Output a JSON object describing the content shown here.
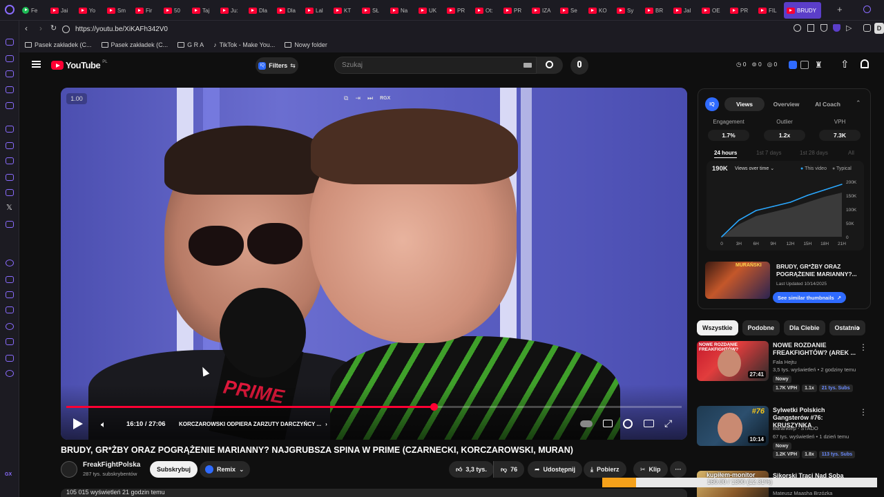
{
  "browser": {
    "tabs": [
      "Fe",
      "Jai",
      "Yo",
      "Sm",
      "Fir",
      "50",
      "Taj",
      "Ju:",
      "Dla",
      "Dla",
      "Lal",
      "KT",
      "SŁ",
      "Na",
      "UK",
      "PR",
      "Ot:",
      "PR",
      "IZA",
      "Se",
      "KO",
      "Sy",
      "BR",
      "Jal",
      "OE",
      "PR",
      "FIL"
    ],
    "active_tab": "BRUDY",
    "url": "https://youtu.be/XiKAFh342V0",
    "bookmarks": [
      "Pasek zakładek (C...",
      "Pasek zakładek (C...",
      "G R A",
      "TikTok - Make You...",
      "Nowy folder"
    ]
  },
  "youtube": {
    "logo": "YouTube",
    "logo_region": "PL",
    "filters_label": "Filters",
    "search_placeholder": "Szukaj",
    "header_counters": [
      "0",
      "0",
      "0"
    ]
  },
  "player": {
    "speed": "1.00",
    "overlay_label": "RGX",
    "time": "16:10 / 27:06",
    "chapter": "KORCZAROWSKI ODPIERA ZARZUTY DARCZYŃCY ...",
    "progress_fraction": 0.597,
    "mic_brand": "PRIME"
  },
  "video": {
    "title": "BRUDY, GR*ŻBY ORAZ POGRĄŻENIE MARIANNY? NAJGRUBSZA SPINA W PRIME (CZARNECKI, KORCZAROWSKI, MURAN)",
    "channel": "FreakFightPolska",
    "subscribers": "287 tys. subskrybentów",
    "subscribe_label": "Subskrybuj",
    "remix_label": "Remix",
    "likes": "3,3 tys.",
    "dislikes": "76",
    "share_label": "Udostępnij",
    "download_label": "Pobierz",
    "clip_label": "Klip",
    "views_line": "105 015 wyświetleń  21 godzin temu"
  },
  "vidiq": {
    "tabs": [
      "Views",
      "Overview",
      "AI Coach"
    ],
    "stats": [
      {
        "label": "Engagement",
        "value": "1.7%"
      },
      {
        "label": "Outlier",
        "value": "1.2x"
      },
      {
        "label": "VPH",
        "value": "7.3K"
      }
    ],
    "periods": [
      "24 hours",
      "1st 7 days",
      "1st 28 days",
      "All"
    ],
    "total_views": "190K",
    "metric_selector": "Views over time",
    "legend": [
      "This video",
      "Typical"
    ],
    "related_title": "BRUDY, GR*ŻBY ORAZ POGRĄŻENIE MARIANNY?...",
    "related_updated": "Last Updated 10/14/2025",
    "similar_btn": "See similar thumbnails"
  },
  "chart_data": {
    "type": "line",
    "x": [
      "0",
      "3H",
      "6H",
      "9H",
      "12H",
      "15H",
      "18H",
      "21H"
    ],
    "y_ticks": [
      "200K",
      "150K",
      "100K",
      "50K",
      "0"
    ],
    "ylim": [
      0,
      200000
    ],
    "series": [
      {
        "name": "This video",
        "values": [
          0,
          60000,
          95000,
          110000,
          125000,
          150000,
          170000,
          190000
        ]
      },
      {
        "name": "Typical",
        "values": [
          0,
          45000,
          75000,
          90000,
          105000,
          125000,
          145000,
          160000
        ]
      }
    ]
  },
  "chips": [
    "Wszystkie",
    "Podobne",
    "Dla Ciebie",
    "Ostatnio"
  ],
  "side_videos": [
    {
      "title": "NOWE ROZDANIE FREAKFIGHTÓW? (AREK ...",
      "channel": "Fala Hejtu",
      "meta": "3,5 tys. wyświetleń • 2 godziny temu",
      "tag": "Nowy",
      "duration": "27:41",
      "badges": [
        "1.7K VPH",
        "1.1x",
        "21 tys. Subs"
      ],
      "thumb_text": "NOWE ROZDANIE FREAKFIGHTÓW?"
    },
    {
      "title": "Sylwetki Polskich Gangsterów #76: KRUSZYNKA",
      "channel": "Barankiep - STADO",
      "meta": "67 tys. wyświetleń • 1 dzień temu",
      "tag": "Nowy",
      "duration": "10:14",
      "badges": [
        "1.2K VPH",
        "1.8x",
        "113 tys. Subs"
      ],
      "thumb_text": "#76"
    },
    {
      "title": "Sikorski Traci Nad Soba",
      "channel": "Mateusz Maasha Brzózka",
      "meta": "",
      "tag": "",
      "duration": "",
      "badges": [],
      "thumb_text": "kupiłem-monitor"
    }
  ],
  "download_progress": {
    "text": "160.00 / 1300 (12.31%)",
    "fraction": 0.1231
  },
  "colors": {
    "accent_red": "#ff0033",
    "vidiq_blue": "#2f6bff",
    "browser_purple": "#5b3ec9"
  }
}
